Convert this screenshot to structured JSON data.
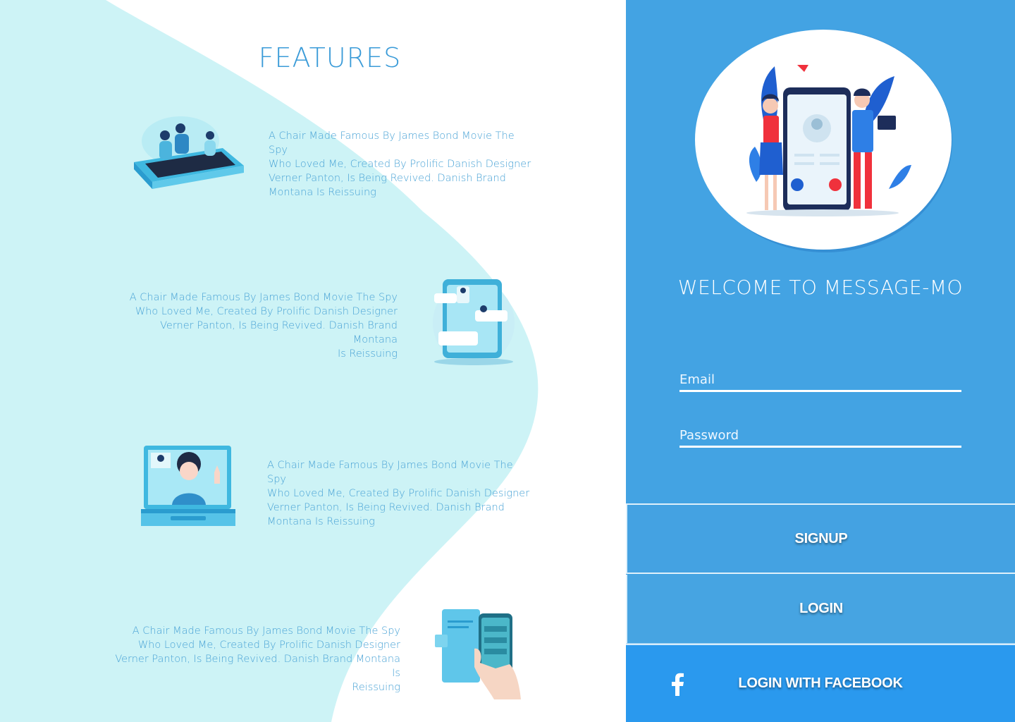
{
  "features": {
    "title": "FEATURES",
    "items": [
      {
        "lines": [
          "A Chair Made Famous By James Bond Movie The Spy",
          "Who Loved Me, Created By Prolific Danish Designer",
          "Verner Panton, Is Being Revived. Danish Brand",
          "Montana Is Reissuing"
        ],
        "illustration": "team-on-tablet-illustration"
      },
      {
        "lines": [
          "A Chair Made Famous By James Bond Movie The Spy",
          "Who Loved Me, Created By Prolific Danish Designer",
          "Verner Panton, Is Being Revived. Danish Brand Montana",
          "Is Reissuing"
        ],
        "illustration": "chat-phone-illustration"
      },
      {
        "lines": [
          "A Chair Made Famous By James Bond Movie The Spy",
          "Who Loved Me, Created By Prolific Danish Designer",
          "Verner Panton, Is Being Revived. Danish Brand",
          "Montana Is Reissuing"
        ],
        "illustration": "video-call-laptop-illustration"
      },
      {
        "lines": [
          "A Chair Made Famous By James Bond Movie The Spy",
          "Who Loved Me, Created By Prolific Danish Designer",
          "Verner Panton, Is Being Revived. Danish Brand Montana Is",
          "Reissuing"
        ],
        "illustration": "hand-holding-phone-illustration"
      }
    ]
  },
  "login": {
    "welcome": "WELCOME TO MESSAGE-MO",
    "email_placeholder": "Email",
    "password_placeholder": "Password",
    "signup_label": "SIGNUP",
    "login_label": "LOGIN",
    "facebook_label": "LOGIN WITH FACEBOOK",
    "hero_illustration": "people-with-phone-call-illustration",
    "facebook_icon": "facebook-icon"
  },
  "colors": {
    "accent_blue": "#43a3e3",
    "facebook_blue": "#2a99ee",
    "wave_cyan": "#cdf3f6",
    "title_blue": "#3a9bd8"
  }
}
